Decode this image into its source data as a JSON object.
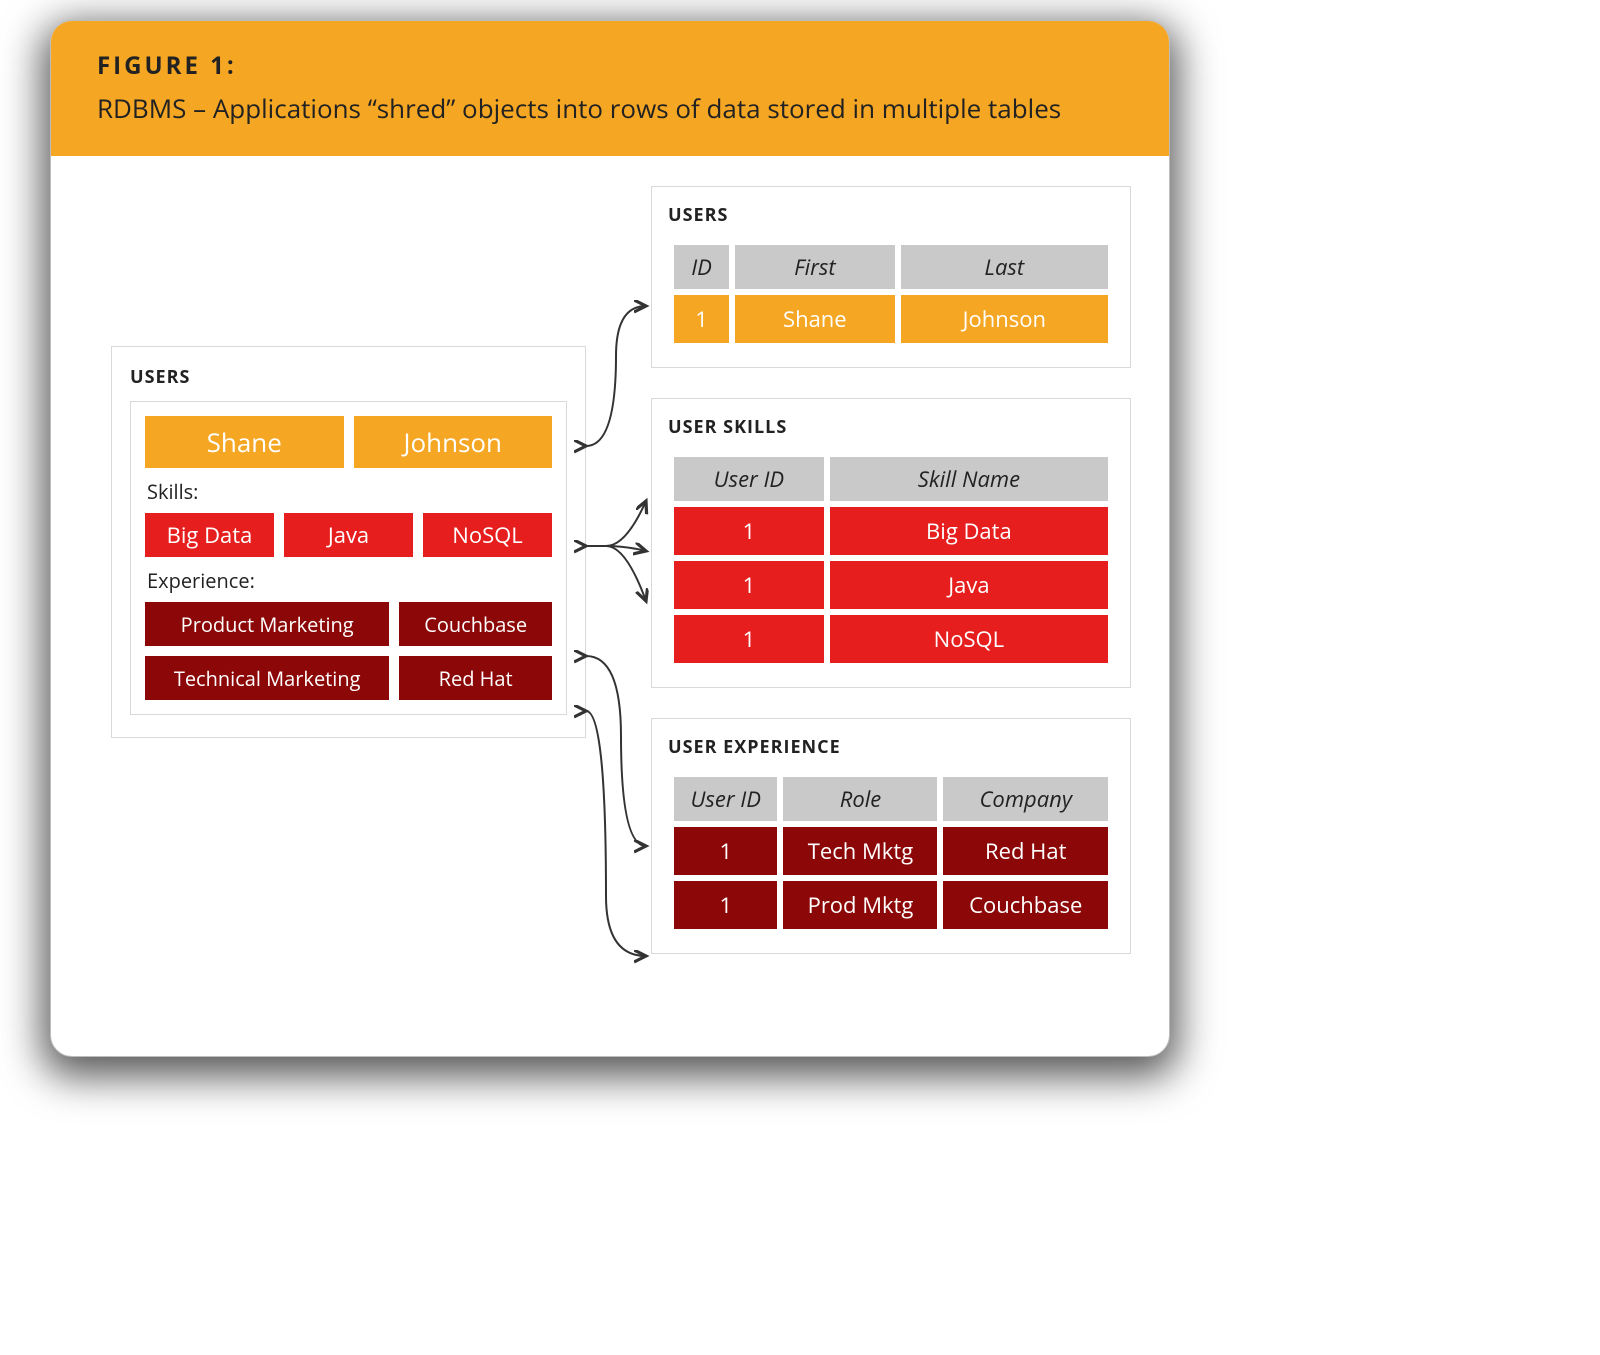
{
  "figure": {
    "label": "FIGURE 1:",
    "title": "RDBMS – Applications “shred” objects into rows of data stored in multiple tables"
  },
  "left_object": {
    "title": "USERS",
    "name": {
      "first": "Shane",
      "last": "Johnson"
    },
    "skills_label": "Skills:",
    "skills": [
      "Big Data",
      "Java",
      "NoSQL"
    ],
    "experience_label": "Experience:",
    "experience": [
      {
        "role": "Product Marketing",
        "company": "Couchbase"
      },
      {
        "role": "Technical Marketing",
        "company": "Red Hat"
      }
    ]
  },
  "tables": {
    "users": {
      "title": "USERS",
      "columns": [
        "ID",
        "First",
        "Last"
      ],
      "rows": [
        [
          "1",
          "Shane",
          "Johnson"
        ]
      ],
      "row_color": "orange"
    },
    "user_skills": {
      "title": "USER SKILLS",
      "columns": [
        "User ID",
        "Skill Name"
      ],
      "rows": [
        [
          "1",
          "Big Data"
        ],
        [
          "1",
          "Java"
        ],
        [
          "1",
          "NoSQL"
        ]
      ],
      "row_color": "red"
    },
    "user_experience": {
      "title": "USER EXPERIENCE",
      "columns": [
        "User ID",
        "Role",
        "Company"
      ],
      "rows": [
        [
          "1",
          "Tech Mktg",
          "Red Hat"
        ],
        [
          "1",
          "Prod Mktg",
          "Couchbase"
        ]
      ],
      "row_color": "darkred"
    }
  }
}
